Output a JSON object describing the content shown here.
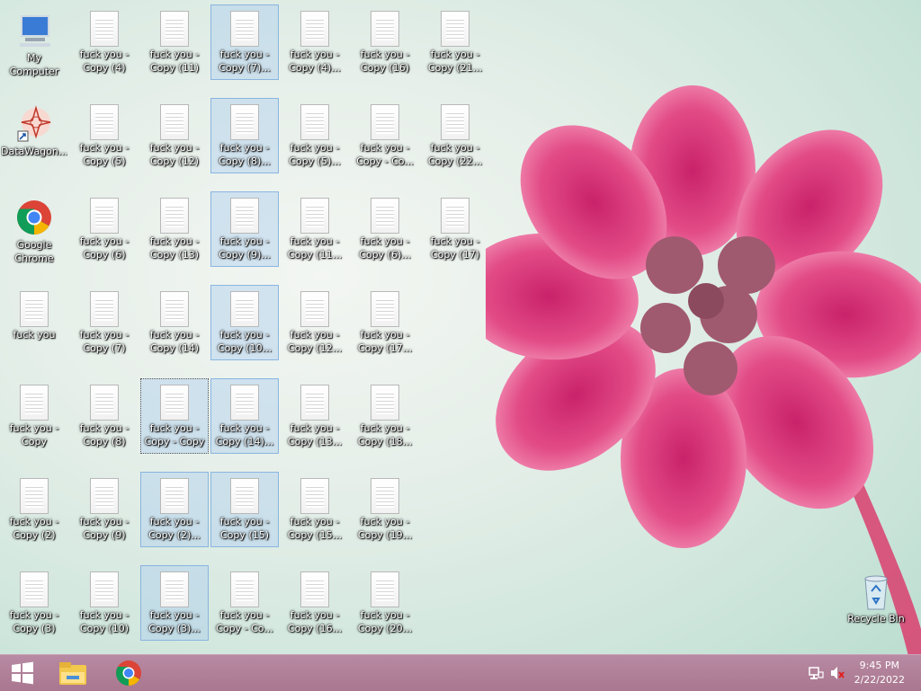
{
  "desktop": {
    "icons": [
      {
        "label": "My Computer",
        "type": "computer"
      },
      {
        "label": "DataWagon...",
        "type": "datawagon"
      },
      {
        "label": "Google Chrome",
        "type": "chrome"
      },
      {
        "label": "fuck you",
        "type": "file"
      },
      {
        "label": "fuck you - Copy",
        "type": "file"
      },
      {
        "label": "fuck you - Copy (2)",
        "type": "file"
      },
      {
        "label": "fuck you - Copy (3)",
        "type": "file"
      },
      {
        "label": "fuck you - Copy (4)",
        "type": "file"
      },
      {
        "label": "fuck you - Copy (5)",
        "type": "file"
      },
      {
        "label": "fuck you - Copy (6)",
        "type": "file"
      },
      {
        "label": "fuck you - Copy (7)",
        "type": "file"
      },
      {
        "label": "fuck you - Copy (8)",
        "type": "file"
      },
      {
        "label": "fuck you - Copy (9)",
        "type": "file"
      },
      {
        "label": "fuck you - Copy (10)",
        "type": "file"
      },
      {
        "label": "fuck you - Copy (11)",
        "type": "file"
      },
      {
        "label": "fuck you - Copy (12)",
        "type": "file"
      },
      {
        "label": "fuck you - Copy (13)",
        "type": "file"
      },
      {
        "label": "fuck you - Copy (14)",
        "type": "file"
      },
      {
        "label": "fuck you - Copy - Copy",
        "type": "file",
        "selected": true,
        "focused": true
      },
      {
        "label": "fuck you - Copy (2)...",
        "type": "file",
        "selected": true
      },
      {
        "label": "fuck you - Copy (3)...",
        "type": "file",
        "selected": true
      },
      {
        "label": "fuck you - Copy (7)...",
        "type": "file",
        "selected": true
      },
      {
        "label": "fuck you - Copy (8)...",
        "type": "file",
        "selected": true
      },
      {
        "label": "fuck you - Copy (9)...",
        "type": "file",
        "selected": true
      },
      {
        "label": "fuck you - Copy (10...",
        "type": "file",
        "selected": true
      },
      {
        "label": "fuck you - Copy (14)...",
        "type": "file",
        "selected": true
      },
      {
        "label": "fuck you - Copy (15)",
        "type": "file",
        "selected": true
      },
      {
        "label": "fuck you - Copy - Co...",
        "type": "file"
      },
      {
        "label": "fuck you - Copy (4)...",
        "type": "file"
      },
      {
        "label": "fuck you - Copy (5)...",
        "type": "file"
      },
      {
        "label": "fuck you - Copy (11...",
        "type": "file"
      },
      {
        "label": "fuck you - Copy (12...",
        "type": "file"
      },
      {
        "label": "fuck you - Copy (13...",
        "type": "file"
      },
      {
        "label": "fuck you - Copy (15...",
        "type": "file"
      },
      {
        "label": "fuck you - Copy (16...",
        "type": "file"
      },
      {
        "label": "fuck you - Copy (16)",
        "type": "file"
      },
      {
        "label": "fuck you - Copy - Co...",
        "type": "file"
      },
      {
        "label": "fuck you - Copy (6)...",
        "type": "file"
      },
      {
        "label": "fuck you - Copy (17...",
        "type": "file"
      },
      {
        "label": "fuck you - Copy (18...",
        "type": "file"
      },
      {
        "label": "fuck you - Copy (19...",
        "type": "file"
      },
      {
        "label": "fuck you - Copy (20...",
        "type": "file"
      },
      {
        "label": "fuck you - Copy (21...",
        "type": "file"
      },
      {
        "label": "fuck you - Copy (22...",
        "type": "file"
      },
      {
        "label": "fuck you - Copy (17)",
        "type": "file"
      },
      {
        "label": "Recycle Bin",
        "type": "recycle"
      }
    ]
  },
  "taskbar": {
    "start_icon": "windows-logo-icon",
    "pinned": [
      "file-explorer-icon",
      "chrome-icon"
    ],
    "tray": [
      "network-icon",
      "volume-muted-icon"
    ],
    "time": "9:45 PM",
    "date": "2/22/2022"
  },
  "colors": {
    "taskbar": "#ad7b94",
    "selection": "#adcff0",
    "flower": "#e0467f"
  }
}
